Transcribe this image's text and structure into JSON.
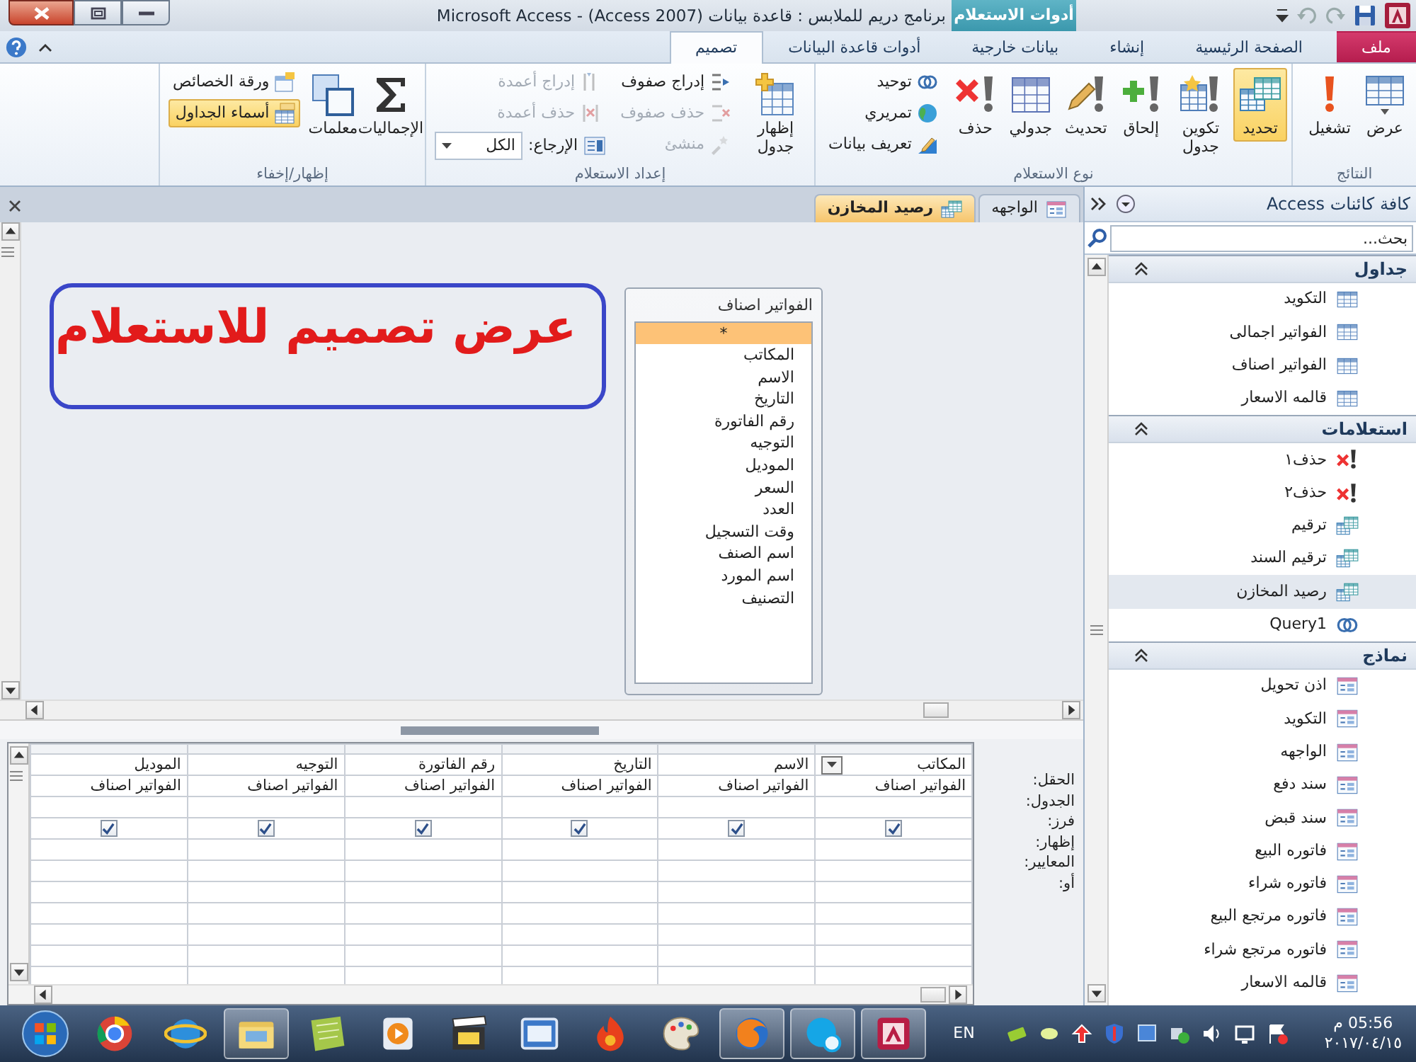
{
  "window": {
    "title": "Microsoft Access - (Access 2007) برنامج دريم للملابس : قاعدة بيانات",
    "context_tab": "أدوات الاستعلام"
  },
  "ribbon_tabs": [
    {
      "label": "ملف",
      "kind": "file",
      "selected": false
    },
    {
      "label": "الصفحة الرئيسية",
      "kind": "tab",
      "selected": false
    },
    {
      "label": "إنشاء",
      "kind": "tab",
      "selected": false
    },
    {
      "label": "بيانات خارجية",
      "kind": "tab",
      "selected": false
    },
    {
      "label": "أدوات قاعدة البيانات",
      "kind": "tab",
      "selected": false
    },
    {
      "label": "تصميم",
      "kind": "tab",
      "selected": true
    }
  ],
  "ribbon_groups": [
    {
      "title": "النتائج",
      "buttons": [
        {
          "kind": "large",
          "label": "عرض",
          "selected": false,
          "disabled": false
        },
        {
          "kind": "large",
          "label": "تشغيل",
          "selected": false,
          "disabled": false
        }
      ]
    },
    {
      "title": "نوع الاستعلام",
      "buttons": [
        {
          "kind": "large",
          "label": "تحديد",
          "selected": true,
          "disabled": false
        },
        {
          "kind": "large",
          "label": "تكوين جدول",
          "selected": false,
          "disabled": false
        },
        {
          "kind": "large",
          "label": "إلحاق",
          "selected": false,
          "disabled": false
        },
        {
          "kind": "large",
          "label": "تحديث",
          "selected": false,
          "disabled": false
        },
        {
          "kind": "large",
          "label": "جدولي",
          "selected": false,
          "disabled": false
        },
        {
          "kind": "large",
          "label": "حذف",
          "selected": false,
          "disabled": false
        },
        {
          "kind": "small",
          "label": "توحيد",
          "selected": false,
          "disabled": false
        },
        {
          "kind": "small",
          "label": "تمريري",
          "selected": false,
          "disabled": false
        },
        {
          "kind": "small",
          "label": "تعريف بيانات",
          "selected": false,
          "disabled": false
        }
      ]
    },
    {
      "title": "إعداد الاستعلام",
      "buttons": [
        {
          "kind": "large",
          "label": "إظهار جدول",
          "selected": false,
          "disabled": false
        },
        {
          "kind": "small",
          "label": "إدراج صفوف",
          "selected": false,
          "disabled": false
        },
        {
          "kind": "small",
          "label": "حذف صفوف",
          "selected": false,
          "disabled": true
        },
        {
          "kind": "small",
          "label": "منشئ",
          "selected": false,
          "disabled": true
        },
        {
          "kind": "small",
          "label": "إدراج أعمدة",
          "selected": false,
          "disabled": true
        },
        {
          "kind": "small",
          "label": "حذف أعمدة",
          "selected": false,
          "disabled": true
        },
        {
          "kind": "combo",
          "label": "الإرجاع:",
          "value": "الكل",
          "selected": false,
          "disabled": false
        }
      ]
    },
    {
      "title": "إظهار/إخفاء",
      "buttons": [
        {
          "kind": "large",
          "label": "الإجماليات",
          "selected": false,
          "disabled": false
        },
        {
          "kind": "large",
          "label": "معلمات",
          "selected": false,
          "disabled": false
        },
        {
          "kind": "small",
          "label": "ورقة الخصائص",
          "selected": false,
          "disabled": false
        },
        {
          "kind": "small",
          "label": "أسماء الجداول",
          "selected": true,
          "disabled": false
        }
      ]
    }
  ],
  "document_tabs": [
    {
      "label": "الواجهه",
      "kind": "form",
      "selected": false
    },
    {
      "label": "رصيد المخازن",
      "kind": "query",
      "selected": true
    }
  ],
  "annotation": {
    "text": "عرض تصميم للاستعلام"
  },
  "field_list": {
    "title": "الفواتير اصناف",
    "fields": [
      {
        "label": "*",
        "selected": true
      },
      {
        "label": "المكاتب",
        "selected": false
      },
      {
        "label": "الاسم",
        "selected": false
      },
      {
        "label": "التاريخ",
        "selected": false
      },
      {
        "label": "رقم الفاتورة",
        "selected": false
      },
      {
        "label": "التوجيه",
        "selected": false
      },
      {
        "label": "الموديل",
        "selected": false
      },
      {
        "label": "السعر",
        "selected": false
      },
      {
        "label": "العدد",
        "selected": false
      },
      {
        "label": "وقت التسجيل",
        "selected": false
      },
      {
        "label": "اسم الصنف",
        "selected": false
      },
      {
        "label": "اسم المورد",
        "selected": false
      },
      {
        "label": "التصنيف",
        "selected": false
      }
    ]
  },
  "grid": {
    "row_labels": [
      "الحقل:",
      "الجدول:",
      "فرز:",
      "إظهار:",
      "المعايير:",
      "أو:"
    ],
    "columns": [
      {
        "field": "المكاتب",
        "table": "الفواتير اصناف",
        "show": true,
        "focused": true
      },
      {
        "field": "الاسم",
        "table": "الفواتير اصناف",
        "show": true,
        "focused": false
      },
      {
        "field": "التاريخ",
        "table": "الفواتير اصناف",
        "show": true,
        "focused": false
      },
      {
        "field": "رقم الفاتورة",
        "table": "الفواتير اصناف",
        "show": true,
        "focused": false
      },
      {
        "field": "التوجيه",
        "table": "الفواتير اصناف",
        "show": true,
        "focused": false
      },
      {
        "field": "الموديل",
        "table": "الفواتير اصناف",
        "show": true,
        "focused": false
      }
    ]
  },
  "navigation": {
    "title": "كافة كائنات Access",
    "search": {
      "placeholder": "بحث..."
    },
    "groups": [
      {
        "title": "جداول",
        "items": [
          {
            "label": "التكويد",
            "kind": "table",
            "selected": false
          },
          {
            "label": "الفواتير اجمالى",
            "kind": "table",
            "selected": false
          },
          {
            "label": "الفواتير اصناف",
            "kind": "table",
            "selected": false
          },
          {
            "label": "قالمه الاسعار",
            "kind": "table",
            "selected": false
          }
        ]
      },
      {
        "title": "استعلامات",
        "items": [
          {
            "label": "حذف١",
            "kind": "delete_query",
            "selected": false
          },
          {
            "label": "حذف٢",
            "kind": "delete_query",
            "selected": false
          },
          {
            "label": "ترقيم",
            "kind": "select_query",
            "selected": false
          },
          {
            "label": "ترقيم السند",
            "kind": "select_query",
            "selected": false
          },
          {
            "label": "رصيد المخازن",
            "kind": "select_query",
            "selected": true
          },
          {
            "label": "Query1",
            "kind": "union_query",
            "selected": false
          }
        ]
      },
      {
        "title": "نماذج",
        "items": [
          {
            "label": "اذن تحويل",
            "kind": "form",
            "selected": false
          },
          {
            "label": "التكويد",
            "kind": "form",
            "selected": false
          },
          {
            "label": "الواجهه",
            "kind": "form",
            "selected": false
          },
          {
            "label": "سند دفع",
            "kind": "form",
            "selected": false
          },
          {
            "label": "سند قبض",
            "kind": "form",
            "selected": false
          },
          {
            "label": "فاتوره البيع",
            "kind": "form",
            "selected": false
          },
          {
            "label": "فاتوره شراء",
            "kind": "form",
            "selected": false
          },
          {
            "label": "فاتوره مرتجع البيع",
            "kind": "form",
            "selected": false
          },
          {
            "label": "فاتوره مرتجع شراء",
            "kind": "form",
            "selected": false
          },
          {
            "label": "قالمه الاسعار",
            "kind": "form",
            "selected": false
          }
        ]
      }
    ]
  },
  "taskbar": {
    "apps": [
      {
        "running": false
      },
      {
        "running": false
      },
      {
        "running": true
      },
      {
        "running": false
      },
      {
        "running": false
      },
      {
        "running": false
      },
      {
        "running": false
      },
      {
        "running": false
      },
      {
        "running": false
      },
      {
        "running": true
      },
      {
        "running": true
      },
      {
        "running": true
      }
    ],
    "language": "EN",
    "time": "05:56 م",
    "date": "٢٠١٧/٠٤/١٥"
  }
}
